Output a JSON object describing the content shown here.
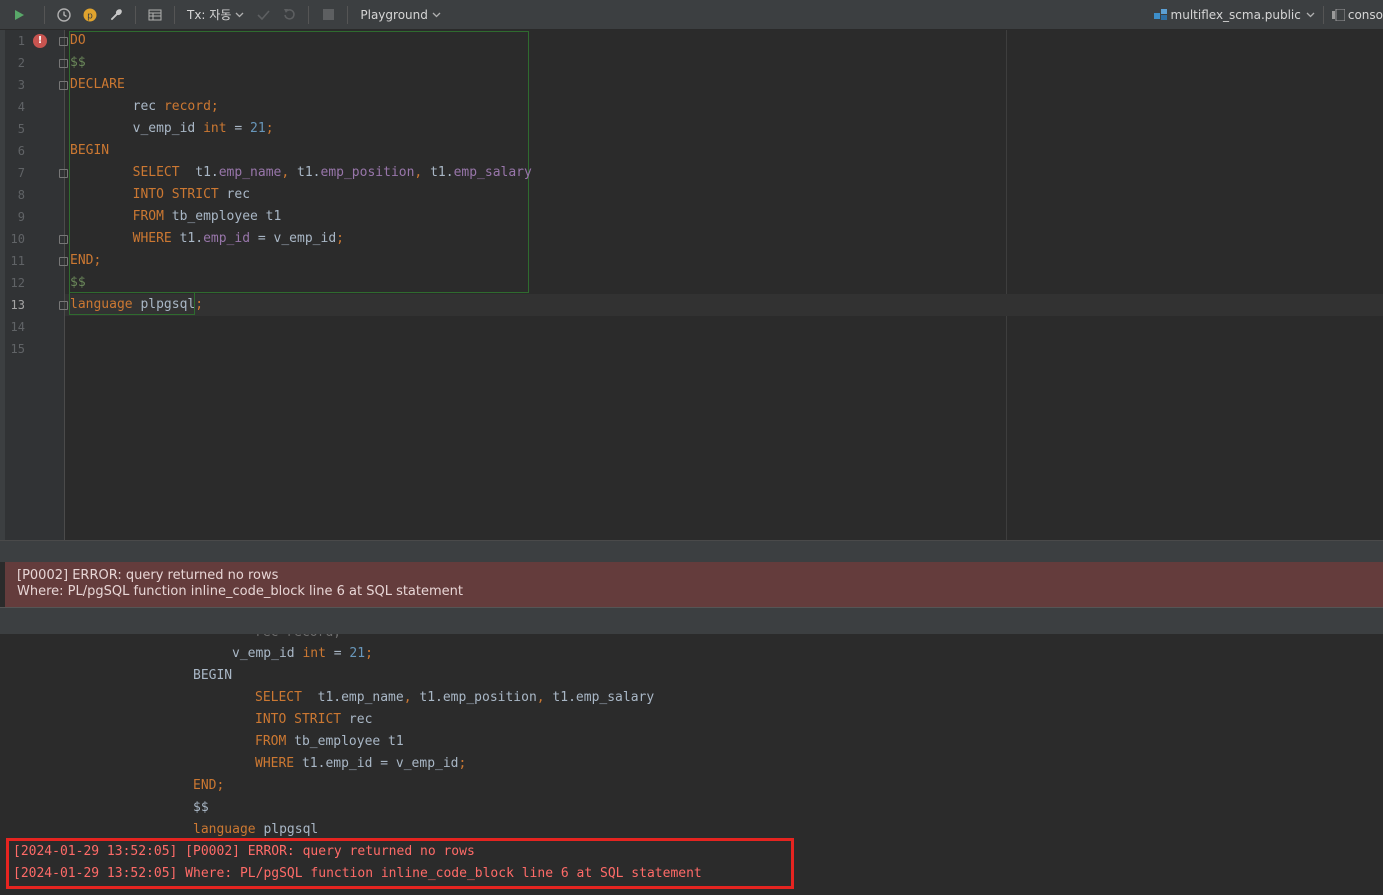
{
  "toolbar": {
    "tx_label": "Tx: 자동",
    "playground_label": "Playground",
    "schema_label": "multiflex_scma.public",
    "console_label": "conso",
    "colors": {
      "run": "#59a869",
      "profile": "#e0a32e"
    }
  },
  "editor": {
    "line_numbers": [
      "1",
      "2",
      "3",
      "4",
      "5",
      "6",
      "7",
      "8",
      "9",
      "10",
      "11",
      "12",
      "13",
      "14",
      "15"
    ],
    "lines": {
      "l1": {
        "kw": "DO"
      },
      "l2": {
        "dl": "$$"
      },
      "l3": {
        "kw": "DECLARE"
      },
      "l4": {
        "indent": "        ",
        "name": "rec ",
        "type": "record",
        "semi": ";"
      },
      "l5": {
        "indent": "        ",
        "name": "v_emp_id ",
        "type": "int",
        "eq": " = ",
        "num": "21",
        "semi": ";"
      },
      "l6": {
        "kw": "BEGIN"
      },
      "l7": {
        "indent": "        ",
        "kw": "SELECT",
        "sp": "  ",
        "t1a": "t1.",
        "f1": "emp_name",
        "c1": ", ",
        "t1b": "t1.",
        "f2": "emp_position",
        "c2": ", ",
        "t1c": "t1.",
        "f3": "emp_salary"
      },
      "l8": {
        "indent": "        ",
        "kw": "INTO STRICT",
        "rest": " rec"
      },
      "l9": {
        "indent": "        ",
        "kw": "FROM",
        "rest": " tb_employee t1"
      },
      "l10": {
        "indent": "        ",
        "kw": "WHERE",
        "t1": " t1.",
        "f": "emp_id",
        "rest": " = v_emp_id",
        "semi": ";"
      },
      "l11": {
        "kw": "END",
        "semi": ";"
      },
      "l12": {
        "dl": "$$"
      },
      "l13": {
        "kw": "language",
        "rest": " plpgsql",
        "semi": ";"
      }
    }
  },
  "error_panel": {
    "line1": "[P0002] ERROR: query returned no rows",
    "line2": "Where: PL/pgSQL function inline_code_block line 6 at SQL statement"
  },
  "console": {
    "partial_top": "rec record;",
    "l_vemp": {
      "name": "v_emp_id ",
      "type": "int",
      "eq": " = ",
      "num": "21",
      "semi": ";"
    },
    "l_begin": "BEGIN",
    "l_select": {
      "kw": "SELECT",
      "rest": "  t1.emp_name",
      "c1": ",",
      "rest2": " t1.emp_position",
      "c2": ",",
      "rest3": " t1.emp_salary"
    },
    "l_into": {
      "kw": "INTO STRICT",
      "rest": " rec"
    },
    "l_from": {
      "kw": "FROM",
      "rest": " tb_employee t1"
    },
    "l_where": {
      "kw": "WHERE",
      "rest": " t1.emp_id = v_emp_id",
      "semi": ";"
    },
    "l_end": {
      "kw": "END",
      "semi": ";"
    },
    "l_dollar": "$$",
    "l_lang": {
      "kw": "language",
      "rest": " plpgsql"
    },
    "log1": "[2024-01-29 13:52:05] [P0002] ERROR: query returned no rows",
    "log2": "[2024-01-29 13:52:05] Where: PL/pgSQL function inline_code_block line 6 at SQL statement"
  }
}
